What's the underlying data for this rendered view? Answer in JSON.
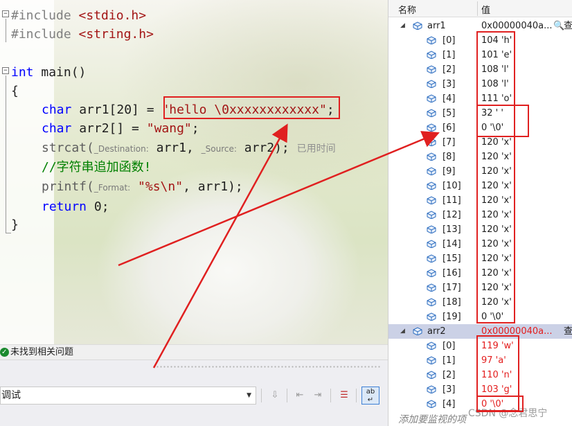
{
  "editor": {
    "lines": {
      "l1_kw": "#include",
      "l1_arg": "<stdio.h>",
      "l2_kw": "#include",
      "l2_arg": "<string.h>",
      "l3_type": "int",
      "l3_rest": " main()",
      "l4": "{",
      "l5_type": "char",
      "l5_decl": " arr1[20] = ",
      "l5_str": "\"hello \\0xxxxxxxxxxxx\"",
      "l5_end": ";",
      "l6_type": "char",
      "l6_decl": " arr2[] = ",
      "l6_str": "\"wang\"",
      "l6_end": ";",
      "l7_fn": "strcat(",
      "l7_hint1": "_Destination:",
      "l7_arg1": " arr1, ",
      "l7_hint2": "_Source:",
      "l7_arg2": " arr2);",
      "l7_time": "已用时间",
      "l8_comment": "//字符串追加函数!",
      "l9_fn": "printf(",
      "l9_hint": "_Format:",
      "l9_str": "\"%s\\n\"",
      "l9_rest": ", arr1);",
      "l10_kw": "return",
      "l10_rest": " 0;",
      "l11": "}"
    }
  },
  "status": {
    "message": "未找到相关问题"
  },
  "output": {
    "source_value": "调试"
  },
  "watch": {
    "header": {
      "name": "名称",
      "value": "值"
    },
    "arr1": {
      "name": "arr1",
      "value": "0x00000040a...",
      "search_glyph": "🔍",
      "more": "查",
      "elements": [
        {
          "index": "[0]",
          "value": "104 'h'"
        },
        {
          "index": "[1]",
          "value": "101 'e'"
        },
        {
          "index": "[2]",
          "value": "108 'l'"
        },
        {
          "index": "[3]",
          "value": "108 'l'"
        },
        {
          "index": "[4]",
          "value": "111 'o'"
        },
        {
          "index": "[5]",
          "value": "32 ' '"
        },
        {
          "index": "[6]",
          "value": "0 '\\0'"
        },
        {
          "index": "[7]",
          "value": "120 'x'"
        },
        {
          "index": "[8]",
          "value": "120 'x'"
        },
        {
          "index": "[9]",
          "value": "120 'x'"
        },
        {
          "index": "[10]",
          "value": "120 'x'"
        },
        {
          "index": "[11]",
          "value": "120 'x'"
        },
        {
          "index": "[12]",
          "value": "120 'x'"
        },
        {
          "index": "[13]",
          "value": "120 'x'"
        },
        {
          "index": "[14]",
          "value": "120 'x'"
        },
        {
          "index": "[15]",
          "value": "120 'x'"
        },
        {
          "index": "[16]",
          "value": "120 'x'"
        },
        {
          "index": "[17]",
          "value": "120 'x'"
        },
        {
          "index": "[18]",
          "value": "120 'x'"
        },
        {
          "index": "[19]",
          "value": "0 '\\0'"
        }
      ]
    },
    "arr2": {
      "name": "arr2",
      "value": "0x00000040a...",
      "more": "查",
      "elements": [
        {
          "index": "[0]",
          "value": "119 'w'"
        },
        {
          "index": "[1]",
          "value": "97 'a'"
        },
        {
          "index": "[2]",
          "value": "110 'n'"
        },
        {
          "index": "[3]",
          "value": "103 'g'"
        },
        {
          "index": "[4]",
          "value": "0 '\\0'"
        }
      ]
    },
    "add_watch_placeholder": "添加要监视的项",
    "watermark": "CSDN @念君思宁"
  },
  "colors": {
    "annotation_red": "#e02020",
    "changed_value_red": "#e31c1c",
    "keyword_blue": "#0000ff",
    "string_red": "#a31515",
    "comment_green": "#008000",
    "selection_blue": "#cbd1e6"
  }
}
